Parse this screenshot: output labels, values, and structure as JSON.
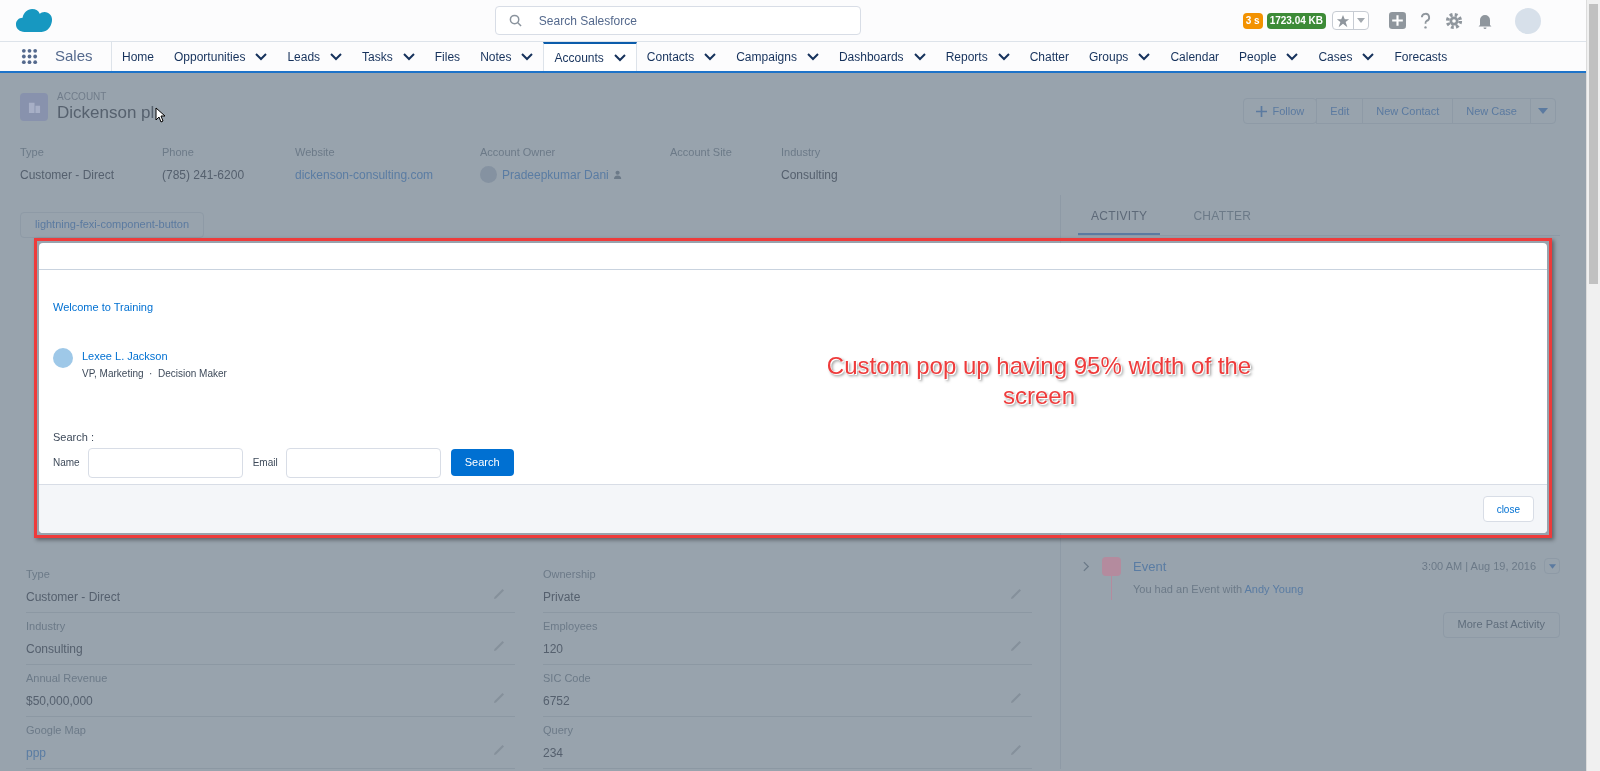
{
  "app": {
    "name": "Sales"
  },
  "search": {
    "placeholder": "Search Salesforce"
  },
  "header_badges": [
    {
      "text": "3 s",
      "color": "#f39200"
    },
    {
      "text": "1723.04 KB",
      "color": "#3d8b37"
    }
  ],
  "nav_tabs": [
    {
      "label": "Home",
      "selected": false,
      "dropdown": false
    },
    {
      "label": "Opportunities",
      "selected": false,
      "dropdown": true
    },
    {
      "label": "Leads",
      "selected": false,
      "dropdown": true
    },
    {
      "label": "Tasks",
      "selected": false,
      "dropdown": true
    },
    {
      "label": "Files",
      "selected": false,
      "dropdown": false
    },
    {
      "label": "Notes",
      "selected": false,
      "dropdown": true
    },
    {
      "label": "Accounts",
      "selected": true,
      "dropdown": true
    },
    {
      "label": "Contacts",
      "selected": false,
      "dropdown": true
    },
    {
      "label": "Campaigns",
      "selected": false,
      "dropdown": true
    },
    {
      "label": "Dashboards",
      "selected": false,
      "dropdown": true
    },
    {
      "label": "Reports",
      "selected": false,
      "dropdown": true
    },
    {
      "label": "Chatter",
      "selected": false,
      "dropdown": false
    },
    {
      "label": "Groups",
      "selected": false,
      "dropdown": true
    },
    {
      "label": "Calendar",
      "selected": false,
      "dropdown": false
    },
    {
      "label": "People",
      "selected": false,
      "dropdown": true
    },
    {
      "label": "Cases",
      "selected": false,
      "dropdown": true
    },
    {
      "label": "Forecasts",
      "selected": false,
      "dropdown": false
    }
  ],
  "record": {
    "object_type": "ACCOUNT",
    "name": "Dickenson pl"
  },
  "actions": [
    {
      "label": "Follow",
      "kind": "follow"
    },
    {
      "label": "Edit",
      "kind": "plain"
    },
    {
      "label": "New Contact",
      "kind": "plain"
    },
    {
      "label": "New Case",
      "kind": "plain"
    }
  ],
  "highlights": [
    {
      "label": "Type",
      "value": "Customer - Direct",
      "kind": "text"
    },
    {
      "label": "Phone",
      "value": "(785) 241-6200",
      "kind": "text"
    },
    {
      "label": "Website",
      "value": "dickenson-consulting.com",
      "kind": "link"
    },
    {
      "label": "Account Owner",
      "value": "Pradeepkumar Dani",
      "kind": "user"
    },
    {
      "label": "Account Site",
      "kind": "text"
    },
    {
      "label": "Industry",
      "value": "Consulting",
      "kind": "text"
    }
  ],
  "component_button": "lightning-fexi-component-button",
  "details": [
    {
      "label": "Type",
      "value": "Customer - Direct",
      "kind": "text"
    },
    {
      "label": "Ownership",
      "value": "Private",
      "kind": "text"
    },
    {
      "label": "Industry",
      "value": "Consulting",
      "kind": "text"
    },
    {
      "label": "Employees",
      "value": "120",
      "kind": "text"
    },
    {
      "label": "Annual Revenue",
      "value": "$50,000,000",
      "kind": "text"
    },
    {
      "label": "SIC Code",
      "value": "6752",
      "kind": "text"
    },
    {
      "label": "Google Map",
      "value": "ppp",
      "kind": "link"
    },
    {
      "label": "Query",
      "value": "234",
      "kind": "text"
    }
  ],
  "activity_tabs": [
    {
      "label": "ACTIVITY",
      "selected": true
    },
    {
      "label": "CHATTER",
      "selected": false
    }
  ],
  "activity_items": [
    {
      "title": "Event",
      "time": "3:00 AM | Aug 19, 2016",
      "text": "You had an Event with",
      "link": "Andy Young"
    }
  ],
  "more_button": "More Past Activity",
  "modal": {
    "heading": "Welcome to Training",
    "contact": {
      "name": "Lexee L. Jackson",
      "title": "VP, Marketing",
      "separator": "·",
      "role": "Decision Maker"
    },
    "search_label": "Search :",
    "fields": [
      {
        "label": "Name"
      },
      {
        "label": "Email"
      }
    ],
    "search_button": "Search",
    "close_button": "close"
  },
  "annotation": {
    "text": "Custom pop up having 95% width of the screen"
  }
}
